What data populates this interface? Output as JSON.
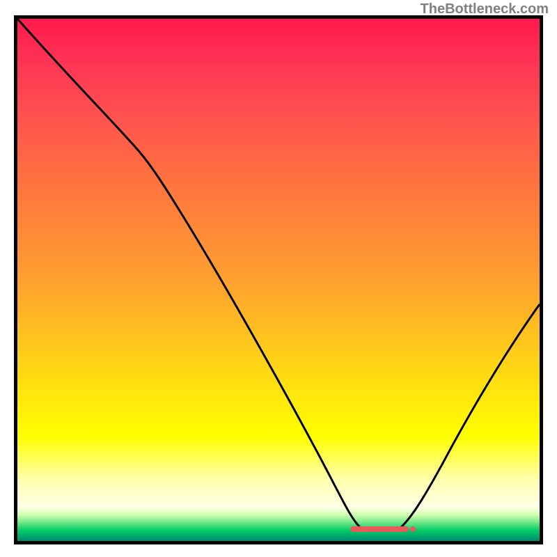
{
  "watermark": "TheBottleneck.com",
  "chart_data": {
    "type": "line",
    "title": "",
    "xlabel": "",
    "ylabel": "",
    "xlim": [
      0,
      100
    ],
    "ylim": [
      0,
      100
    ],
    "series": [
      {
        "name": "bottleneck-curve",
        "x": [
          0,
          20,
          58,
          65,
          72,
          82,
          100
        ],
        "y": [
          100,
          80,
          14,
          2,
          2,
          14,
          45
        ]
      }
    ],
    "background_gradient": {
      "type": "vertical",
      "stops": [
        {
          "pos": 0,
          "color": "#ff1a4d"
        },
        {
          "pos": 50,
          "color": "#ffa030"
        },
        {
          "pos": 80,
          "color": "#ffff00"
        },
        {
          "pos": 100,
          "color": "#00cc66"
        }
      ]
    },
    "markers": [
      {
        "name": "optimal-range",
        "x_start": 62,
        "x_end": 73,
        "y": 2,
        "color": "#e85a5a"
      }
    ]
  }
}
